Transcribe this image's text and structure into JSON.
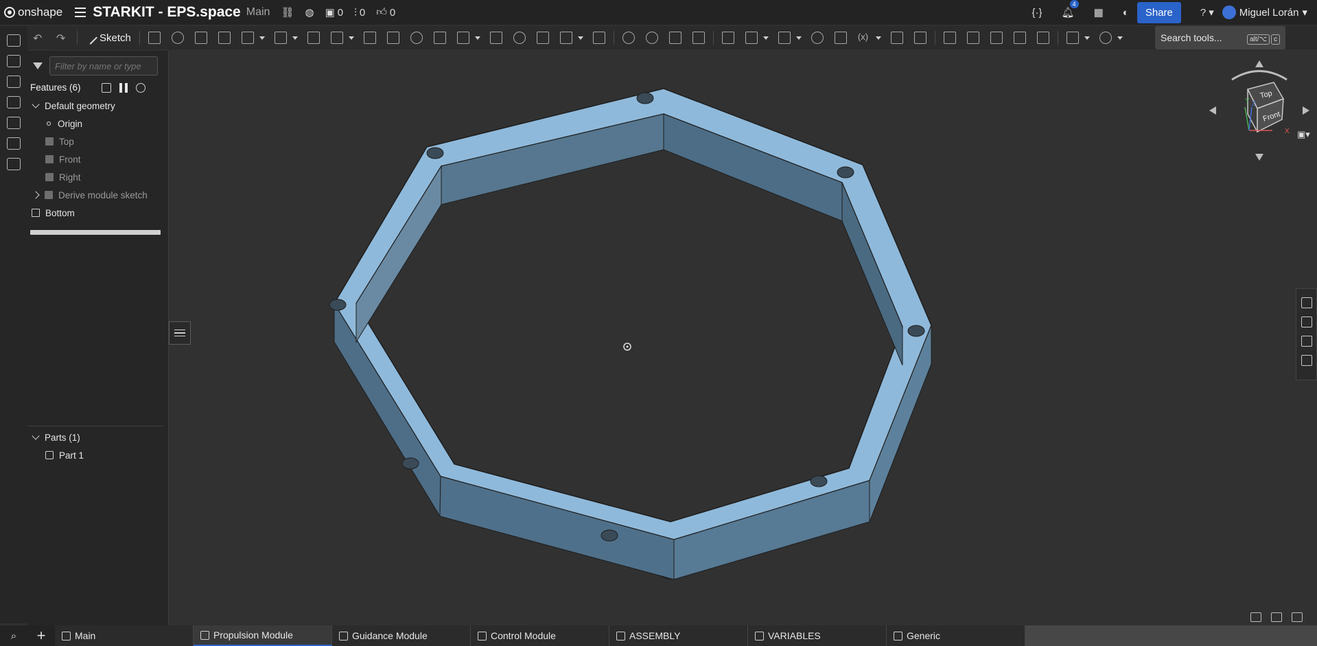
{
  "topbar": {
    "logo_text": "onshape",
    "doc_title": "STARKIT - EPS.space",
    "branch": "Main",
    "versions_count": "0",
    "branches_count": "0",
    "likes_count": "0",
    "notifications_count": "4",
    "share_label": "Share",
    "help_label": "?",
    "user_name": "Miguel Lorán"
  },
  "toolbar": {
    "sketch_label": "Sketch",
    "search_placeholder": "Search tools...",
    "shortcut_key1": "alt/⌥",
    "shortcut_key2": "c"
  },
  "feature_panel": {
    "filter_placeholder": "Filter by name or type",
    "features_header": "Features (6)",
    "default_geometry_label": "Default geometry",
    "origin_label": "Origin",
    "planes": [
      "Top",
      "Front",
      "Right"
    ],
    "derive_label": "Derive module sketch",
    "bottom_label": "Bottom",
    "parts_header": "Parts (1)",
    "part_label": "Part 1"
  },
  "viewcube": {
    "top_label": "Top",
    "front_label": "Front",
    "axis_x": "X",
    "axis_y": "Y",
    "axis_z": "Z"
  },
  "tabs": [
    {
      "label": "Main",
      "icon": "part-studio-icon",
      "active": false
    },
    {
      "label": "Propulsion Module",
      "icon": "part-studio-icon",
      "active": true
    },
    {
      "label": "Guidance Module",
      "icon": "part-studio-icon",
      "active": false
    },
    {
      "label": "Control Module",
      "icon": "part-studio-icon",
      "active": false
    },
    {
      "label": "ASSEMBLY",
      "icon": "assembly-icon",
      "active": false
    },
    {
      "label": "VARIABLES",
      "icon": "variable-studio-icon",
      "active": false
    },
    {
      "label": "Generic",
      "icon": "folder-icon",
      "active": false
    }
  ],
  "colors": {
    "accent": "#2a63c9",
    "part_top": "#8fbbdc",
    "part_side": "#4e6f88",
    "background": "#313131"
  }
}
